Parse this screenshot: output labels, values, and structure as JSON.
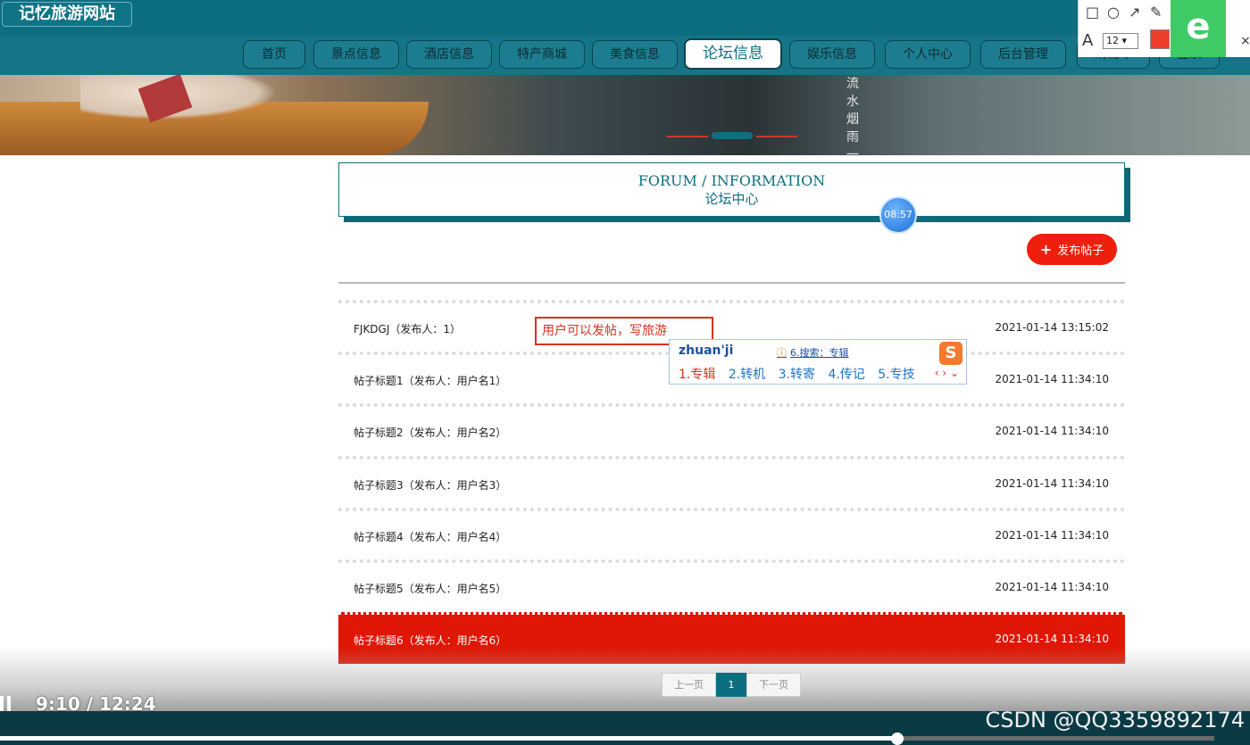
{
  "site": {
    "title": "记忆旅游网站"
  },
  "nav": [
    {
      "label": "首页"
    },
    {
      "label": "景点信息"
    },
    {
      "label": "酒店信息"
    },
    {
      "label": "特产商城"
    },
    {
      "label": "美食信息"
    },
    {
      "label": "论坛信息",
      "active": true
    },
    {
      "label": "娱乐信息"
    },
    {
      "label": "个人中心"
    },
    {
      "label": "后台管理"
    },
    {
      "label": "购物车"
    },
    {
      "label": "登录"
    }
  ],
  "banner": {
    "caption": "流水烟雨一"
  },
  "forum": {
    "title_en": "FORUM / INFORMATION",
    "title_cn": "论坛中心",
    "post_button": "发布帖子"
  },
  "recording": {
    "timer_bubble": "08:57",
    "playback": "9:10 / 12:24",
    "progress": 0.739
  },
  "posts": [
    {
      "title": "FJKDGJ（发布人：1）",
      "time": "2021-01-14 13:15:02"
    },
    {
      "title": "帖子标题1（发布人：用户名1）",
      "time": "2021-01-14 11:34:10"
    },
    {
      "title": "帖子标题2（发布人：用户名2）",
      "time": "2021-01-14 11:34:10"
    },
    {
      "title": "帖子标题3（发布人：用户名3）",
      "time": "2021-01-14 11:34:10"
    },
    {
      "title": "帖子标题4（发布人：用户名4）",
      "time": "2021-01-14 11:34:10"
    },
    {
      "title": "帖子标题5（发布人：用户名5）",
      "time": "2021-01-14 11:34:10"
    },
    {
      "title": "帖子标题6（发布人：用户名6）",
      "time": "2021-01-14 11:34:10",
      "selected": true
    }
  ],
  "pager": {
    "prev": "上一页",
    "current": "1",
    "next": "下一页"
  },
  "annotation": {
    "text": "用户可以发帖，写旅游"
  },
  "ime": {
    "pinyin": "zhuan'ji",
    "search": "6.搜索：专辑",
    "candidates": [
      "1.专辑",
      "2.转机",
      "3.转寄",
      "4.传记",
      "5.专技"
    ]
  },
  "annot_toolbar": {
    "font_size": "12",
    "color": "#f03e2c"
  },
  "watermark": "CSDN @QQ3359892174",
  "colors": {
    "primary": "#0d6e80",
    "accent": "#ee1f0c"
  }
}
